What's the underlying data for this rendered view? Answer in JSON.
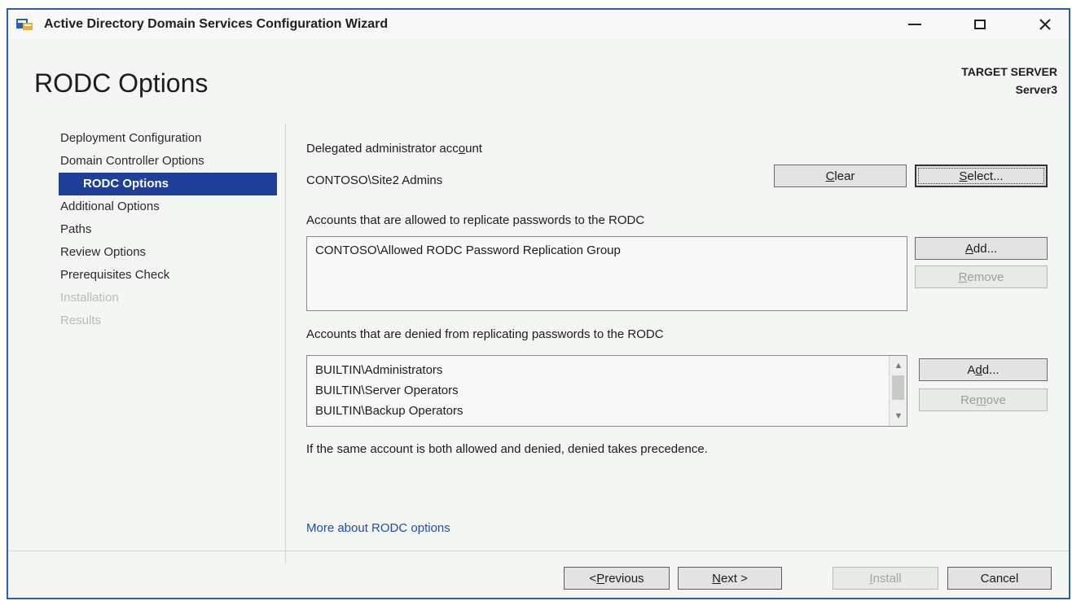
{
  "window": {
    "title": "Active Directory Domain Services Configuration Wizard"
  },
  "header": {
    "page_title": "RODC Options",
    "target_label": "TARGET SERVER",
    "target_server": "Server3"
  },
  "nav": {
    "items": [
      {
        "label": "Deployment Configuration",
        "state": "normal"
      },
      {
        "label": "Domain Controller Options",
        "state": "normal"
      },
      {
        "label": "RODC Options",
        "state": "selected"
      },
      {
        "label": "Additional Options",
        "state": "normal"
      },
      {
        "label": "Paths",
        "state": "normal"
      },
      {
        "label": "Review Options",
        "state": "normal"
      },
      {
        "label": "Prerequisites Check",
        "state": "normal"
      },
      {
        "label": "Installation",
        "state": "disabled"
      },
      {
        "label": "Results",
        "state": "disabled"
      }
    ]
  },
  "delegated": {
    "label_pre": "Delegated administrator acc",
    "label_u": "o",
    "label_post": "unt",
    "value": "CONTOSO\\Site2 Admins",
    "clear_u": "C",
    "clear_rest": "lear",
    "select_u": "S",
    "select_rest": "elect..."
  },
  "allowed": {
    "label": "Accounts that are allowed to replicate passwords to the RODC",
    "items": [
      "CONTOSO\\Allowed RODC Password Replication Group"
    ],
    "add_u": "A",
    "add_rest": "dd...",
    "remove_u": "R",
    "remove_rest": "emove"
  },
  "denied": {
    "label": "Accounts that are denied from replicating passwords to the RODC",
    "items": [
      "BUILTIN\\Administrators",
      "BUILTIN\\Server Operators",
      "BUILTIN\\Backup Operators"
    ],
    "add_pre": "A",
    "add_u": "d",
    "add_post": "d...",
    "remove_pre": "Re",
    "remove_u": "m",
    "remove_post": "ove"
  },
  "note": "If the same account is both allowed and denied, denied takes precedence.",
  "link": "More about RODC options",
  "footer": {
    "prev_pre": "< ",
    "prev_u": "P",
    "prev_rest": "revious",
    "next_u": "N",
    "next_rest": "ext >",
    "install_u": "I",
    "install_rest": "nstall",
    "cancel": "Cancel"
  },
  "colors": {
    "accent": "#1f3f99",
    "window_border": "#2b5fa8",
    "link": "#1e4fa8"
  },
  "icons": {
    "app": "ad-ds-wizard-icon",
    "minimize": "minimize-icon",
    "maximize": "maximize-icon",
    "close": "close-icon"
  }
}
